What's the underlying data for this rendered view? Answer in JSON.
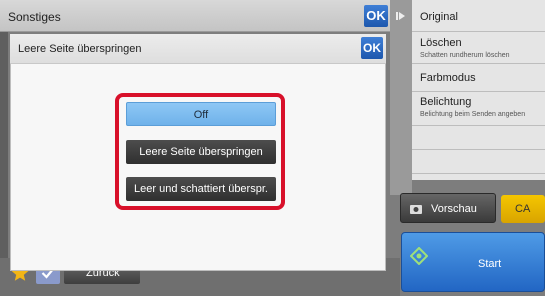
{
  "screen": {
    "title": "Sonstiges",
    "ok_label": "OK"
  },
  "right_menu": {
    "items": [
      {
        "label": "Original",
        "sub": ""
      },
      {
        "label": "Löschen",
        "sub": "Schatten rundherum löschen"
      },
      {
        "label": "Farbmodus",
        "sub": ""
      },
      {
        "label": "Belichtung",
        "sub": "Belichtung beim Senden angeben"
      }
    ]
  },
  "actions": {
    "preview_label": "Vorschau",
    "ca_label": "CA",
    "start_label": "Start",
    "back_label": "Zurück"
  },
  "dialog": {
    "title": "Leere Seite überspringen",
    "ok_label": "OK",
    "options": [
      {
        "label": "Off",
        "selected": true
      },
      {
        "label": "Leere Seite überspringen",
        "selected": false
      },
      {
        "label": "Leer und schattiert überspr.",
        "selected": false
      }
    ]
  },
  "colors": {
    "highlight_frame": "#d8102a",
    "selected_option": "#7dbcf0",
    "ok_blue": "#2a66c0",
    "ca_yellow": "#f0be00",
    "start_blue": "#3a82d8"
  },
  "icons": [
    "play-icon",
    "camera-icon",
    "start-diamond-icon",
    "star-icon",
    "check-icon"
  ]
}
